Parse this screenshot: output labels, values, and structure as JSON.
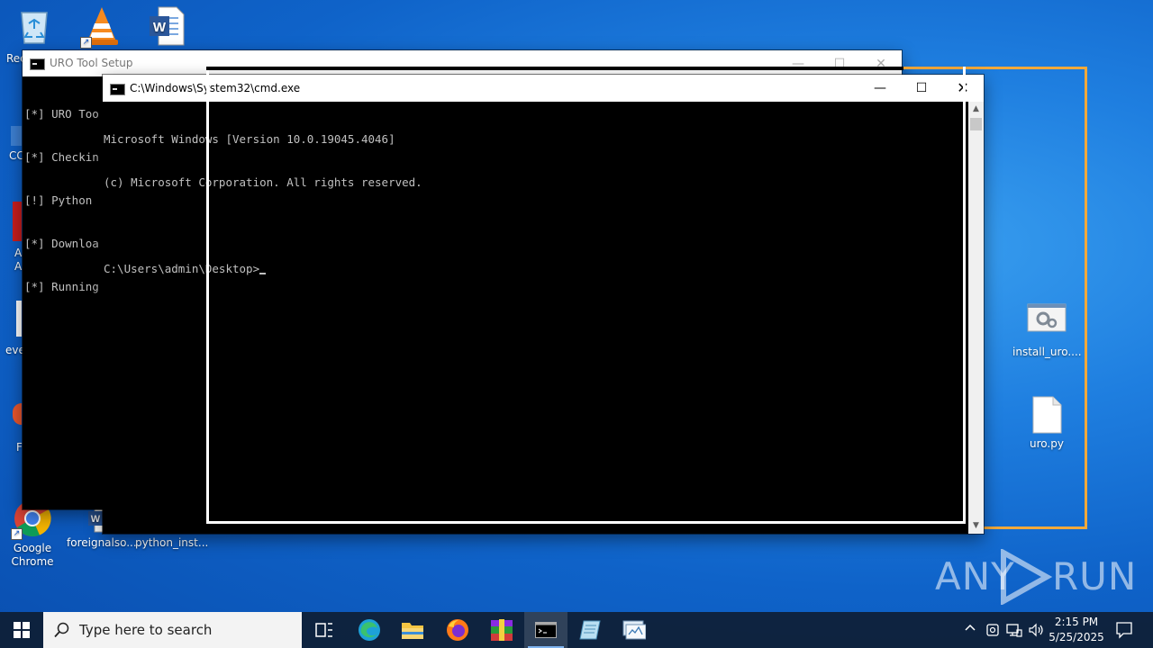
{
  "desktop": {
    "icons": [
      {
        "name": "recycle-bin",
        "label": "Rec"
      },
      {
        "name": "vlc",
        "label": ""
      },
      {
        "name": "word",
        "label": ""
      },
      {
        "name": "google-chrome",
        "label": "Google Chrome"
      },
      {
        "name": "foreignalso",
        "label": "foreignalso..."
      },
      {
        "name": "python-inst",
        "label": "python_inst..."
      },
      {
        "name": "install-uro",
        "label": "install_uro...."
      },
      {
        "name": "uro-py",
        "label": "uro.py"
      }
    ],
    "left_clipped_labels": [
      "CC",
      "A",
      "A",
      "eve",
      "F"
    ]
  },
  "uro_window": {
    "title": "URO Tool Setup",
    "lines": [
      "[*] URO Too",
      "[*] Checkin",
      "[!] Python ",
      "[*] Downloa",
      "[*] Running"
    ]
  },
  "cmd_window": {
    "title": "C:\\Windows\\System32\\cmd.exe",
    "lines": [
      "Microsoft Windows [Version 10.0.19045.4046]",
      "(c) Microsoft Corporation. All rights reserved.",
      "",
      "C:\\Users\\admin\\Desktop>"
    ]
  },
  "watermark": {
    "left": "ANY",
    "right": "RUN"
  },
  "taskbar": {
    "search_placeholder": "Type here to search",
    "time": "2:15 PM",
    "date": "5/25/2025"
  },
  "colors": {
    "highlight_frame": "#f2a93b",
    "taskbar": "#0e1e34"
  }
}
